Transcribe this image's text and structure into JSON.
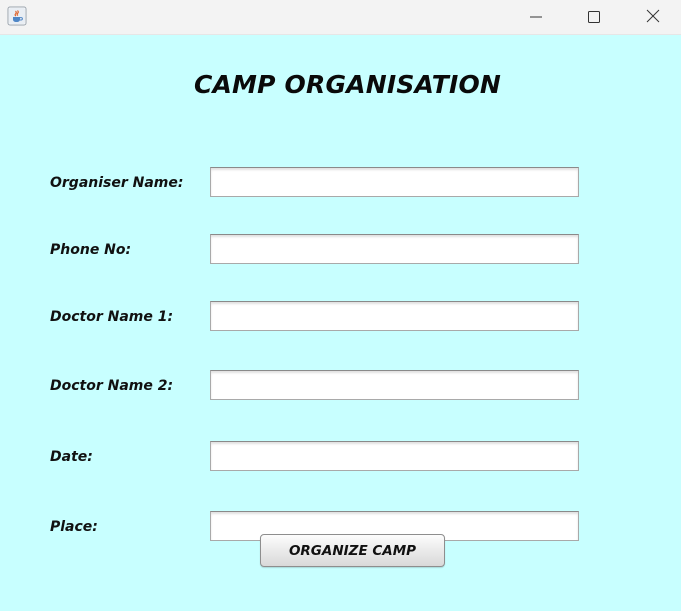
{
  "window": {
    "app_icon": "java-cup-icon",
    "controls": {
      "minimize": "minimize-icon",
      "maximize": "maximize-icon",
      "close": "close-icon"
    }
  },
  "form": {
    "title": "CAMP ORGANISATION",
    "fields": [
      {
        "label": "Organiser Name:",
        "value": ""
      },
      {
        "label": "Phone No:",
        "value": ""
      },
      {
        "label": "Doctor Name 1:",
        "value": ""
      },
      {
        "label": "Doctor Name 2:",
        "value": ""
      },
      {
        "label": "Date:",
        "value": ""
      },
      {
        "label": "Place:",
        "value": ""
      }
    ],
    "submit_label": "ORGANIZE CAMP"
  },
  "colors": {
    "background": "#c8ffff",
    "titlebar": "#f3f3f3"
  }
}
